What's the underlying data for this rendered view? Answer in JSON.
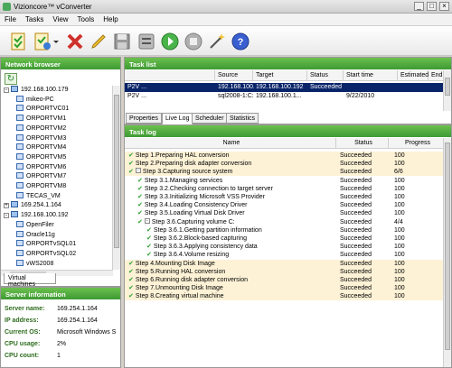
{
  "window": {
    "title": "Vizioncore™ vConverter",
    "min": "_",
    "max": "□",
    "close": "×"
  },
  "menu": [
    "File",
    "Tasks",
    "View",
    "Tools",
    "Help"
  ],
  "toolbar_icons": [
    "new-task-icon",
    "import-icon",
    "dropdown-arrow-icon",
    "delete-icon",
    "edit-icon",
    "save-icon",
    "settings-icon",
    "run-icon",
    "stop-icon",
    "wizard-icon",
    "help-icon"
  ],
  "network_browser": {
    "title": "Network browser",
    "tree": [
      {
        "label": "192.168.100.179",
        "level": 0,
        "type": "net",
        "expander": "-"
      },
      {
        "label": "mikeo-PC",
        "level": 1,
        "type": "vm"
      },
      {
        "label": "ORPORTVC01",
        "level": 1,
        "type": "vm"
      },
      {
        "label": "ORPORTVM1",
        "level": 1,
        "type": "vm"
      },
      {
        "label": "ORPORTVM2",
        "level": 1,
        "type": "vm"
      },
      {
        "label": "ORPORTVM3",
        "level": 1,
        "type": "vm"
      },
      {
        "label": "ORPORTVM4",
        "level": 1,
        "type": "vm"
      },
      {
        "label": "ORPORTVM5",
        "level": 1,
        "type": "vm"
      },
      {
        "label": "ORPORTVM6",
        "level": 1,
        "type": "vm"
      },
      {
        "label": "ORPORTVM7",
        "level": 1,
        "type": "vm"
      },
      {
        "label": "ORPORTVM8",
        "level": 1,
        "type": "vm"
      },
      {
        "label": "TECAS_VM",
        "level": 1,
        "type": "vm"
      },
      {
        "label": "169.254.1.164",
        "level": 0,
        "type": "net",
        "expander": "+"
      },
      {
        "label": "192.168.100.192",
        "level": 0,
        "type": "net",
        "expander": "-"
      },
      {
        "label": "OpenFiler",
        "level": 1,
        "type": "vm"
      },
      {
        "label": "Oracle11g",
        "level": 1,
        "type": "vm"
      },
      {
        "label": "ORPORTvSQL01",
        "level": 1,
        "type": "vm"
      },
      {
        "label": "ORPORTvSQL02",
        "level": 1,
        "type": "vm"
      },
      {
        "label": "vWS2008",
        "level": 1,
        "type": "vm"
      }
    ],
    "tab": "Virtual machines"
  },
  "server_info": {
    "title": "Server information",
    "rows": [
      {
        "label": "Server name:",
        "value": "169.254.1.164"
      },
      {
        "label": "IP address:",
        "value": "169.254.1.164"
      },
      {
        "label": "Current OS:",
        "value": "Microsoft Windows S"
      },
      {
        "label": "CPU usage:",
        "value": "2%"
      },
      {
        "label": "CPU count:",
        "value": "1"
      }
    ]
  },
  "task_list": {
    "title": "Task list",
    "columns": [
      "",
      "Source",
      "Target",
      "Status",
      "Start time",
      "Estimated",
      "End"
    ],
    "rows": [
      {
        "name": "P2V ...",
        "source": "192.168.100.164",
        "target": "192.168.100.192",
        "status": "Succeeded",
        "start": "",
        "selected": true
      },
      {
        "name": "P2V ...",
        "source": "sql2008-1:C:",
        "target": "192.168.100.1...",
        "status": "",
        "start": "9/22/2010",
        "selected": false
      }
    ]
  },
  "tabs": [
    "Properties",
    "Live Log",
    "Scheduler",
    "Statistics"
  ],
  "task_log": {
    "title": "Task log",
    "columns": [
      "Name",
      "Status",
      "Progress"
    ],
    "rows": [
      {
        "name": "Step 1.Preparing HAL conversion",
        "status": "Succeeded",
        "progress": "100",
        "level": 0,
        "exp": "",
        "hl": true
      },
      {
        "name": "Step 2.Preparing disk adapter conversion",
        "status": "Succeeded",
        "progress": "100",
        "level": 0,
        "exp": "",
        "hl": true
      },
      {
        "name": "Step 3.Capturing source system",
        "status": "Succeeded",
        "progress": "6/6",
        "level": 0,
        "exp": "-",
        "hl": true
      },
      {
        "name": "Step 3.1.Managing services",
        "status": "Succeeded",
        "progress": "100",
        "level": 1,
        "exp": "",
        "hl": false
      },
      {
        "name": "Step 3.2.Checking connection to target server",
        "status": "Succeeded",
        "progress": "100",
        "level": 1,
        "exp": "",
        "hl": false
      },
      {
        "name": "Step 3.3.Initializing Microsoft VSS Provider",
        "status": "Succeeded",
        "progress": "100",
        "level": 1,
        "exp": "",
        "hl": false
      },
      {
        "name": "Step 3.4.Loading Consistency Driver",
        "status": "Succeeded",
        "progress": "100",
        "level": 1,
        "exp": "",
        "hl": false
      },
      {
        "name": "Step 3.5.Loading Virtual Disk Driver",
        "status": "Succeeded",
        "progress": "100",
        "level": 1,
        "exp": "",
        "hl": false
      },
      {
        "name": "Step 3.6.Capturing volume C:",
        "status": "Succeeded",
        "progress": "4/4",
        "level": 1,
        "exp": "-",
        "hl": false
      },
      {
        "name": "Step 3.6.1.Getting partition information",
        "status": "Succeeded",
        "progress": "100",
        "level": 2,
        "exp": "",
        "hl": false
      },
      {
        "name": "Step 3.6.2.Block-based capturing",
        "status": "Succeeded",
        "progress": "100",
        "level": 2,
        "exp": "",
        "hl": false
      },
      {
        "name": "Step 3.6.3.Applying consistency data",
        "status": "Succeeded",
        "progress": "100",
        "level": 2,
        "exp": "",
        "hl": false
      },
      {
        "name": "Step 3.6.4.Volume resizing",
        "status": "Succeeded",
        "progress": "100",
        "level": 2,
        "exp": "",
        "hl": false
      },
      {
        "name": "Step 4.Mounting Disk Image",
        "status": "Succeeded",
        "progress": "100",
        "level": 0,
        "exp": "",
        "hl": true
      },
      {
        "name": "Step 5.Running HAL conversion",
        "status": "Succeeded",
        "progress": "100",
        "level": 0,
        "exp": "",
        "hl": true
      },
      {
        "name": "Step 6.Running disk adapter conversion",
        "status": "Succeeded",
        "progress": "100",
        "level": 0,
        "exp": "",
        "hl": true
      },
      {
        "name": "Step 7.Unmounting Disk Image",
        "status": "Succeeded",
        "progress": "100",
        "level": 0,
        "exp": "",
        "hl": true
      },
      {
        "name": "Step 8.Creating virtual machine",
        "status": "Succeeded",
        "progress": "100",
        "level": 0,
        "exp": "",
        "hl": true
      }
    ]
  },
  "colors": {
    "header_green": "#4aa83c",
    "selection": "#0a246a",
    "highlight_row": "#fdf2d6",
    "check_green": "#2ca02c"
  }
}
